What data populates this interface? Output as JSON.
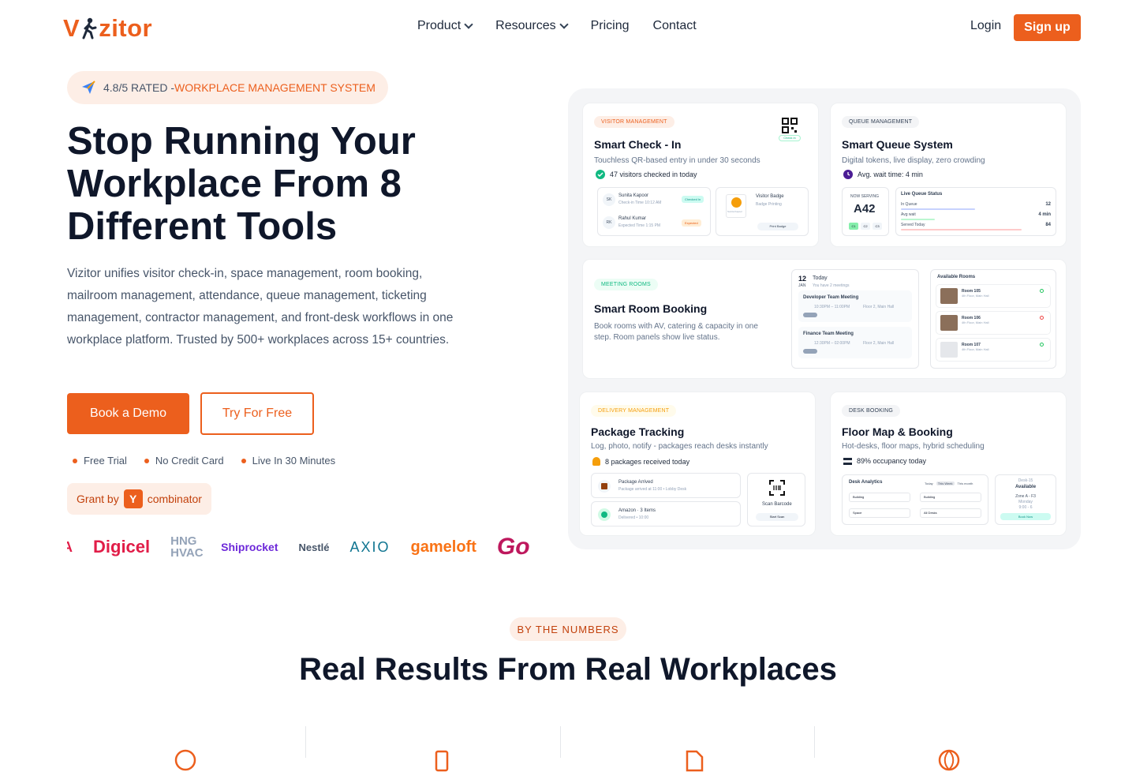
{
  "nav": {
    "logo": "Vizitor",
    "items": [
      {
        "label": "Product",
        "dropdown": true
      },
      {
        "label": "Resources",
        "dropdown": true
      },
      {
        "label": "Pricing",
        "dropdown": false
      },
      {
        "label": "Contact",
        "dropdown": false
      }
    ],
    "login": "Login",
    "signup": "Sign up"
  },
  "hero": {
    "rating": "4.8/5 RATED -",
    "rating_tag": "WORKPLACE MANAGEMENT SYSTEM",
    "title": "Stop Running Your Workplace From 8 Different Tools",
    "description": "Vizitor unifies visitor check-in, space management, room booking, mailroom management, attendance, queue management, ticketing management, contractor management, and front-desk workflows in one workplace platform. Trusted by 500+ workplaces across 15+ countries.",
    "cta_primary": "Book a Demo",
    "cta_secondary": "Try For Free",
    "features": [
      "Free Trial",
      "No Credit Card",
      "Live In 30 Minutes"
    ],
    "grant_prefix": "Grant by",
    "grant_logo": "Y",
    "grant_suffix": "combinator",
    "logos": [
      "A",
      "Digicel",
      "HNG HVAC",
      "Shiprocket",
      "Nestlé",
      "AXIO",
      "gameloft",
      "Go"
    ]
  },
  "cards": {
    "visitor": {
      "tag": "VISITOR MANAGEMENT",
      "title": "Smart Check - In",
      "subtitle": "Touchless QR-based entry in under 30 seconds",
      "stat": "47 visitors checked in today",
      "check_label": "Check in",
      "visitors": [
        {
          "initials": "SK",
          "name": "Sunita Kapoor",
          "meta": "Check-in Time 10:12 AM",
          "status": "Checked In"
        },
        {
          "initials": "RK",
          "name": "Rahul Kumar",
          "meta": "Expected Time 1:15 PM",
          "status": "Expected"
        }
      ],
      "badge_title": "Visitor Badge",
      "badge_sub": "Badge Printing",
      "badge_name": "Sunita Kapoor",
      "badge_button": "Print Badge"
    },
    "queue": {
      "tag": "QUEUE MANAGEMENT",
      "title": "Smart Queue System",
      "subtitle": "Digital tokens, live display, zero crowding",
      "stat": "Avg. wait time: 4 min",
      "now_serving": "NOW SERVING",
      "token": "A42",
      "counters": [
        "C1",
        "C2",
        "C3"
      ],
      "status_title": "Live Queue Status",
      "rows": [
        {
          "label": "In Queue",
          "value": "12",
          "fill": 0.55,
          "color": "#c7d2fe"
        },
        {
          "label": "Avg wait",
          "value": "4 min",
          "fill": 0.25,
          "color": "#bbf7d0"
        },
        {
          "label": "Served Today",
          "value": "84",
          "fill": 0.9,
          "color": "#fecaca"
        }
      ]
    },
    "room": {
      "tag": "MEETING ROOMS",
      "title": "Smart Room Booking",
      "subtitle": "Book rooms with AV, catering & capacity in one step. Room panels show live status.",
      "date_num": "12",
      "date_label": "Today",
      "month": "JAN",
      "meetings_note": "You have 2 meetings",
      "meetings": [
        {
          "title": "Developer Team Meeting",
          "time": "10:30PM – 11:00PM",
          "place": "Floor 2, Main Hall"
        },
        {
          "title": "Finance Team Meeting",
          "time": "12:30PM – 02:00PM",
          "place": "Floor 2, Main Hall"
        }
      ],
      "rooms_title": "Available Rooms",
      "rooms": [
        {
          "name": "Room 105",
          "loc": "4th Floor, Main Hall",
          "status": "#22c55e"
        },
        {
          "name": "Room 106",
          "loc": "4th Floor, Main Hall",
          "status": "#ef4444"
        },
        {
          "name": "Room 107",
          "loc": "4th Floor, Main Hall",
          "status": "#22c55e"
        }
      ]
    },
    "delivery": {
      "tag": "DELIVERY MANAGEMENT",
      "title": "Package Tracking",
      "subtitle": "Log, photo, notify - packages reach desks instantly",
      "stat": "8 packages received today",
      "items": [
        {
          "title": "Package Arrived",
          "meta": "Package arrived at 11:00 • Lobby Desk"
        },
        {
          "title": "Amazon · 3 Items",
          "meta": "Delivered • 10:00"
        }
      ],
      "scan_label": "Scan Barcode",
      "scan_button": "Start Scan"
    },
    "desk": {
      "tag": "DESK BOOKING",
      "title": "Floor Map & Booking",
      "subtitle": "Hot-desks, floor maps, hybrid scheduling",
      "stat": "89% occupancy today",
      "analytics_title": "Desk Analytics",
      "periods": [
        "Today",
        "This Week",
        "This month"
      ],
      "selects": [
        "Building",
        "Building",
        "Space",
        "All Desks"
      ],
      "desk_id": "Desk-15",
      "desk_status": "Available",
      "zone": "Zone A - F3",
      "day": "Monday",
      "time": "9:00 - 6",
      "desk_button": "Book Now"
    }
  },
  "numbers": {
    "tag": "BY THE NUMBERS",
    "title": "Real Results From Real Workplaces"
  },
  "colors": {
    "accent": "#ec5f1d",
    "accent_soft": "#fdeee6",
    "text": "#0f172a",
    "muted": "#475569"
  }
}
